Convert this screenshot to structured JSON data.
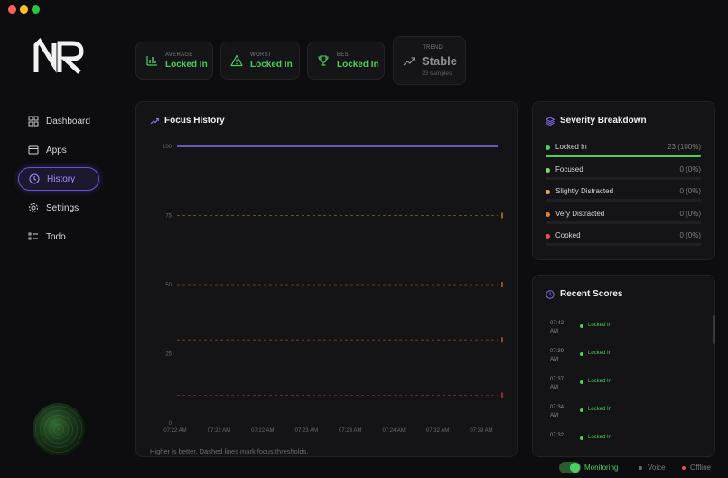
{
  "window": {
    "controls": [
      "close",
      "minimize",
      "zoom"
    ]
  },
  "app": {
    "logo_text": "NR"
  },
  "sidebar": {
    "items": [
      {
        "label": "Dashboard",
        "icon": "dashboard-icon"
      },
      {
        "label": "Apps",
        "icon": "window-icon"
      },
      {
        "label": "History",
        "icon": "clock-icon",
        "active": true
      },
      {
        "label": "Settings",
        "icon": "gear-icon"
      },
      {
        "label": "Todo",
        "icon": "list-icon"
      }
    ]
  },
  "stats": {
    "average": {
      "label": "AVERAGE",
      "value": "Locked In",
      "icon": "bar-chart-icon"
    },
    "worst": {
      "label": "WORST",
      "value": "Locked In",
      "icon": "warning-icon"
    },
    "best": {
      "label": "BEST",
      "value": "Locked In",
      "icon": "trophy-icon"
    },
    "trend": {
      "label": "TREND",
      "value": "Stable",
      "sub": "23 samples",
      "icon": "trend-icon"
    }
  },
  "history": {
    "title": "Focus History",
    "footnote": "Higher is better. Dashed lines mark focus thresholds."
  },
  "chart_data": {
    "type": "line",
    "title": "Focus History",
    "xlabel": "",
    "ylabel": "",
    "ylim": [
      0,
      100
    ],
    "yticks": [
      0,
      25,
      50,
      75,
      100
    ],
    "xticks": [
      "07:22 AM",
      "07:22 AM",
      "07:22 AM",
      "07:23 AM",
      "07:23 AM",
      "07:24 AM",
      "07:32 AM",
      "07:39 AM"
    ],
    "thresholds": [
      {
        "value": 75,
        "color": "#e0a030"
      },
      {
        "value": 50,
        "color": "#e07a30"
      },
      {
        "value": 30,
        "color": "#e06a40"
      },
      {
        "value": 10,
        "color": "#d84a40"
      }
    ],
    "series": [
      {
        "values": [
          100,
          100,
          100,
          100,
          100,
          100,
          100,
          100
        ],
        "color": "#8a6cf0"
      }
    ],
    "grid": false
  },
  "severity": {
    "title": "Severity Breakdown",
    "rows": [
      {
        "label": "Locked In",
        "value": "23 (100%)",
        "fraction": 1.0,
        "color": "#4ccf62"
      },
      {
        "label": "Focused",
        "value": "0 (0%)",
        "fraction": 0,
        "color": "#7fd66a"
      },
      {
        "label": "Slightly Distracted",
        "value": "0 (0%)",
        "fraction": 0,
        "color": "#e6b33a"
      },
      {
        "label": "Very Distracted",
        "value": "0 (0%)",
        "fraction": 0,
        "color": "#e67e35"
      },
      {
        "label": "Cooked",
        "value": "0 (0%)",
        "fraction": 0,
        "color": "#e0524a"
      }
    ]
  },
  "recent": {
    "title": "Recent Scores",
    "rows": [
      {
        "time": "07:42 AM",
        "label": "Locked In"
      },
      {
        "time": "07:39 AM",
        "label": "Locked In"
      },
      {
        "time": "07:37 AM",
        "label": "Locked In"
      },
      {
        "time": "07:34 AM",
        "label": "Locked In"
      },
      {
        "time": "07:32",
        "label": "Locked In"
      }
    ]
  },
  "status": {
    "monitoring": "Monitoring",
    "voice": "Voice",
    "offline": "Offline",
    "colors": {
      "monitoring": "#4ccf62",
      "voice": "#6a6a72",
      "offline": "#e0524a"
    }
  }
}
